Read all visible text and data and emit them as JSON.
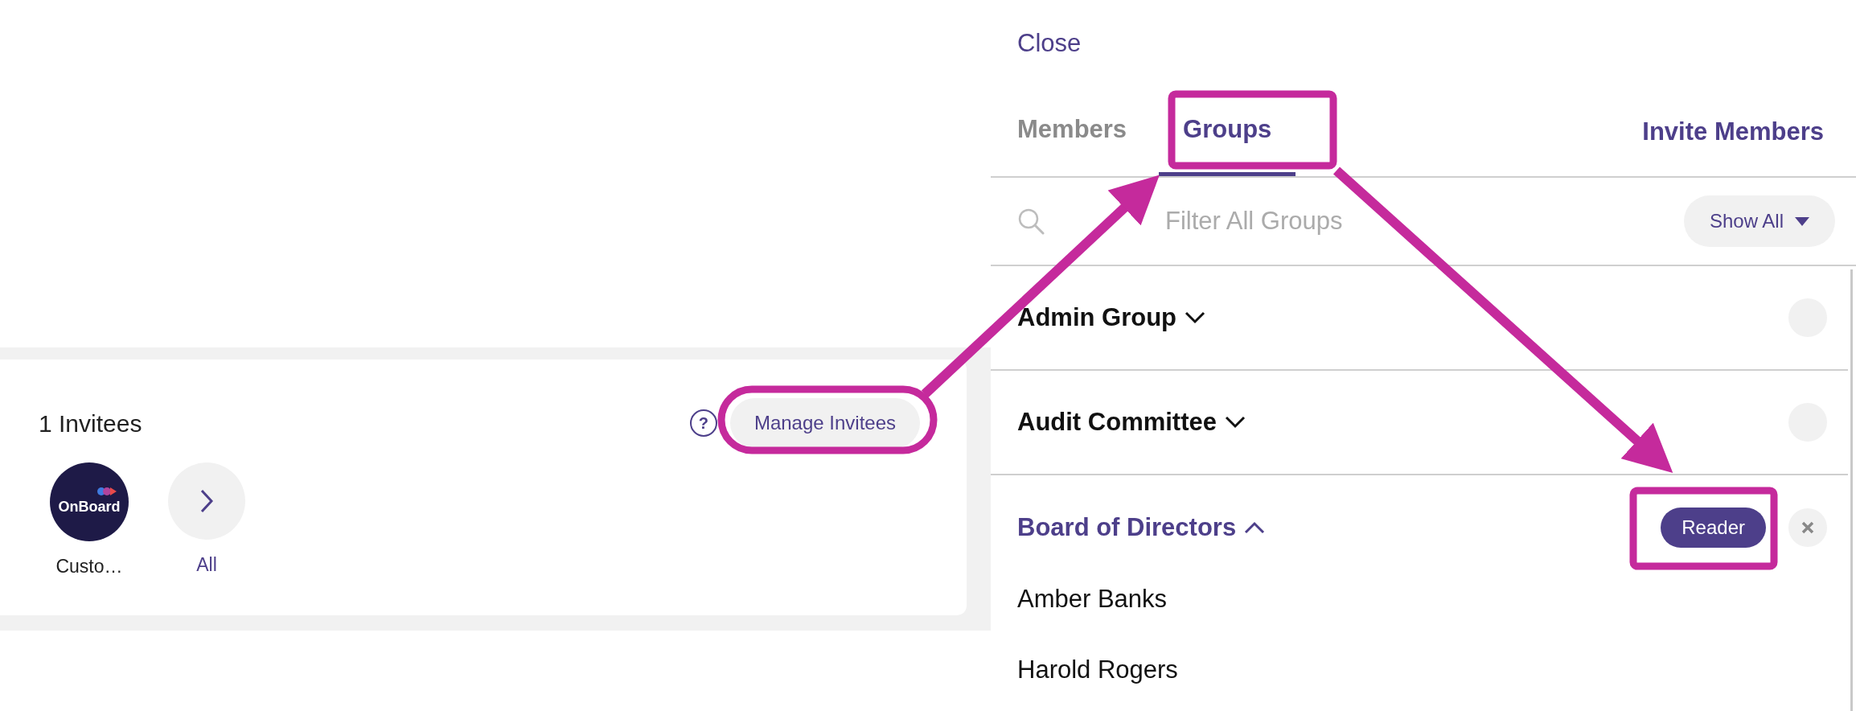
{
  "invitees": {
    "title": "1 Invitees",
    "help": "?",
    "manage_button": "Manage Invitees",
    "avatars": [
      {
        "logo_text": "OnBoard",
        "label": "Custo…"
      }
    ],
    "all_link": "All"
  },
  "panel": {
    "close": "Close",
    "tabs": [
      {
        "label": "Members",
        "selected": false
      },
      {
        "label": "Groups",
        "selected": true
      }
    ],
    "invite": "Invite Members",
    "search": {
      "placeholder": "Filter All Groups"
    },
    "filter": "Show All",
    "groups": [
      {
        "name": "Admin Group",
        "expanded": false
      },
      {
        "name": "Audit Committee",
        "expanded": false
      },
      {
        "name": "Board of Directors",
        "expanded": true,
        "role": "Reader",
        "members": [
          "Amber Banks",
          "Harold Rogers"
        ]
      }
    ]
  }
}
